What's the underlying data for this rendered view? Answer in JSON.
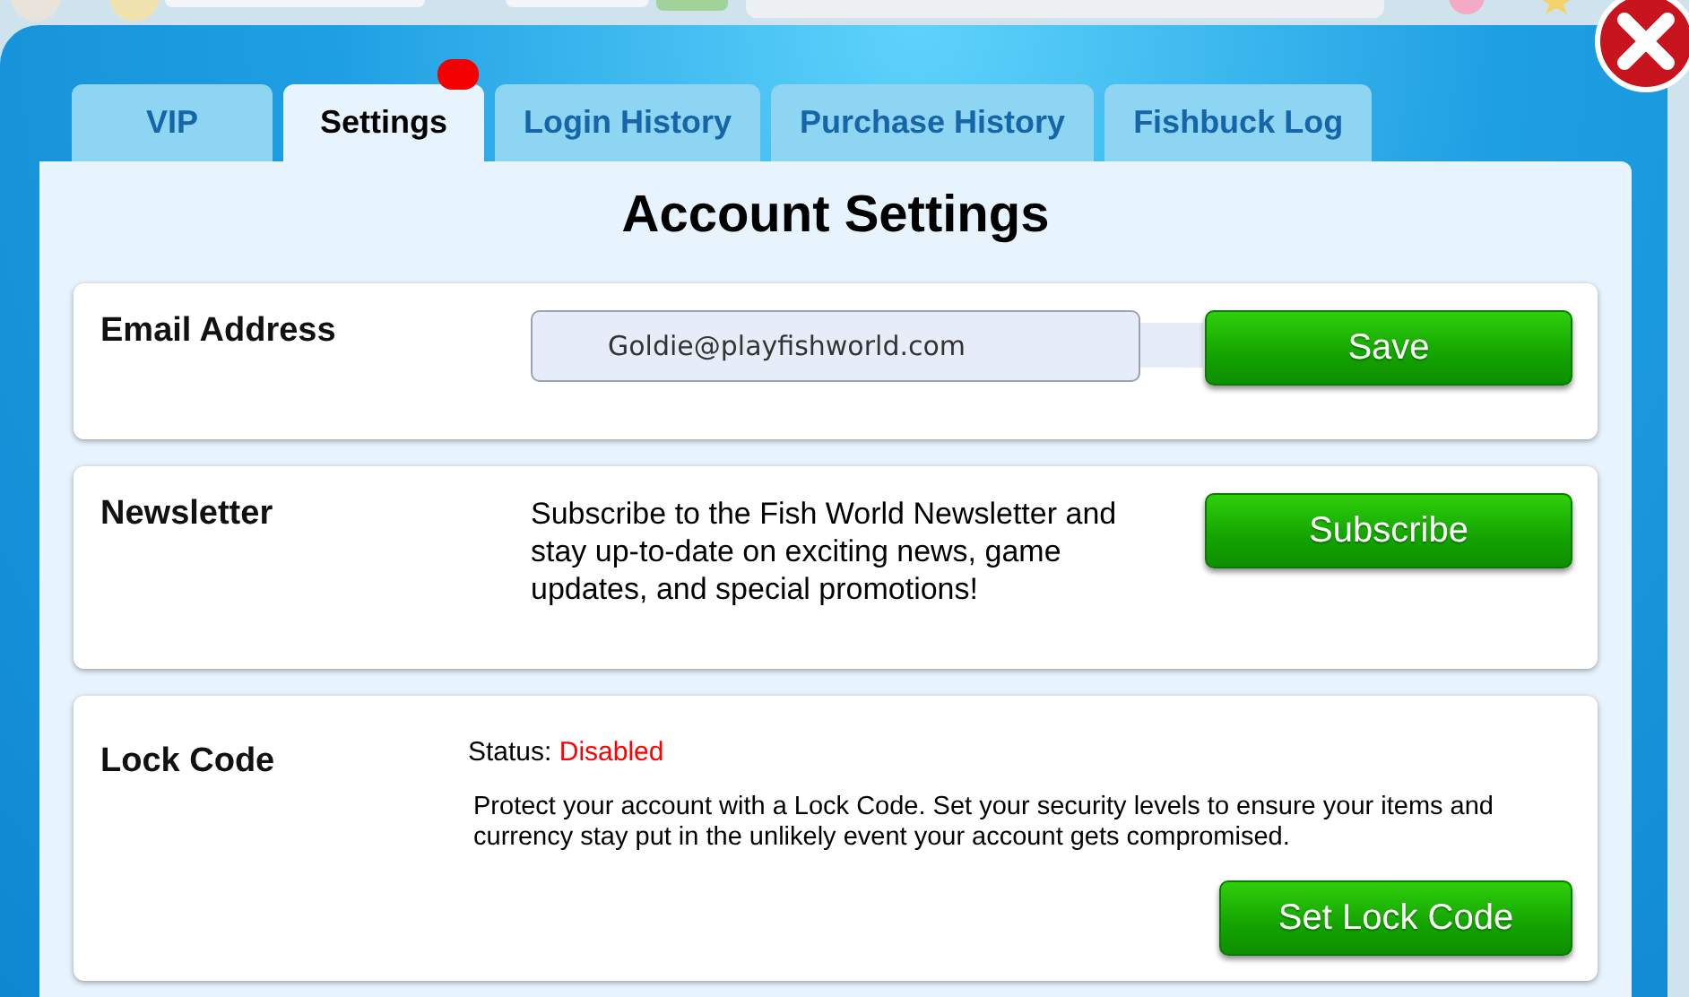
{
  "tabs": [
    {
      "label": "VIP",
      "selected": false,
      "notification": false
    },
    {
      "label": "Settings",
      "selected": true,
      "notification": true
    },
    {
      "label": "Login History",
      "selected": false,
      "notification": false
    },
    {
      "label": "Purchase History",
      "selected": false,
      "notification": false
    },
    {
      "label": "Fishbuck Log",
      "selected": false,
      "notification": false
    }
  ],
  "title": "Account Settings",
  "sections": [
    {
      "kind": "email",
      "label": "Email Address",
      "value": "Goldie@playfishworld.com",
      "button": "Save"
    },
    {
      "kind": "newsletter",
      "label": "Newsletter",
      "text": "Subscribe to the Fish World Newsletter and stay up-to-date on exciting news, game updates, and special promotions!",
      "button": "Subscribe"
    },
    {
      "kind": "lock",
      "label": "Lock Code",
      "status_label": "Status:",
      "status": "Disabled",
      "enabled": false,
      "text": "Protect your account with a Lock Code. Set your security levels to ensure your items and currency stay put in the unlikely event your account gets compromised.",
      "button": "Set Lock Code"
    }
  ]
}
